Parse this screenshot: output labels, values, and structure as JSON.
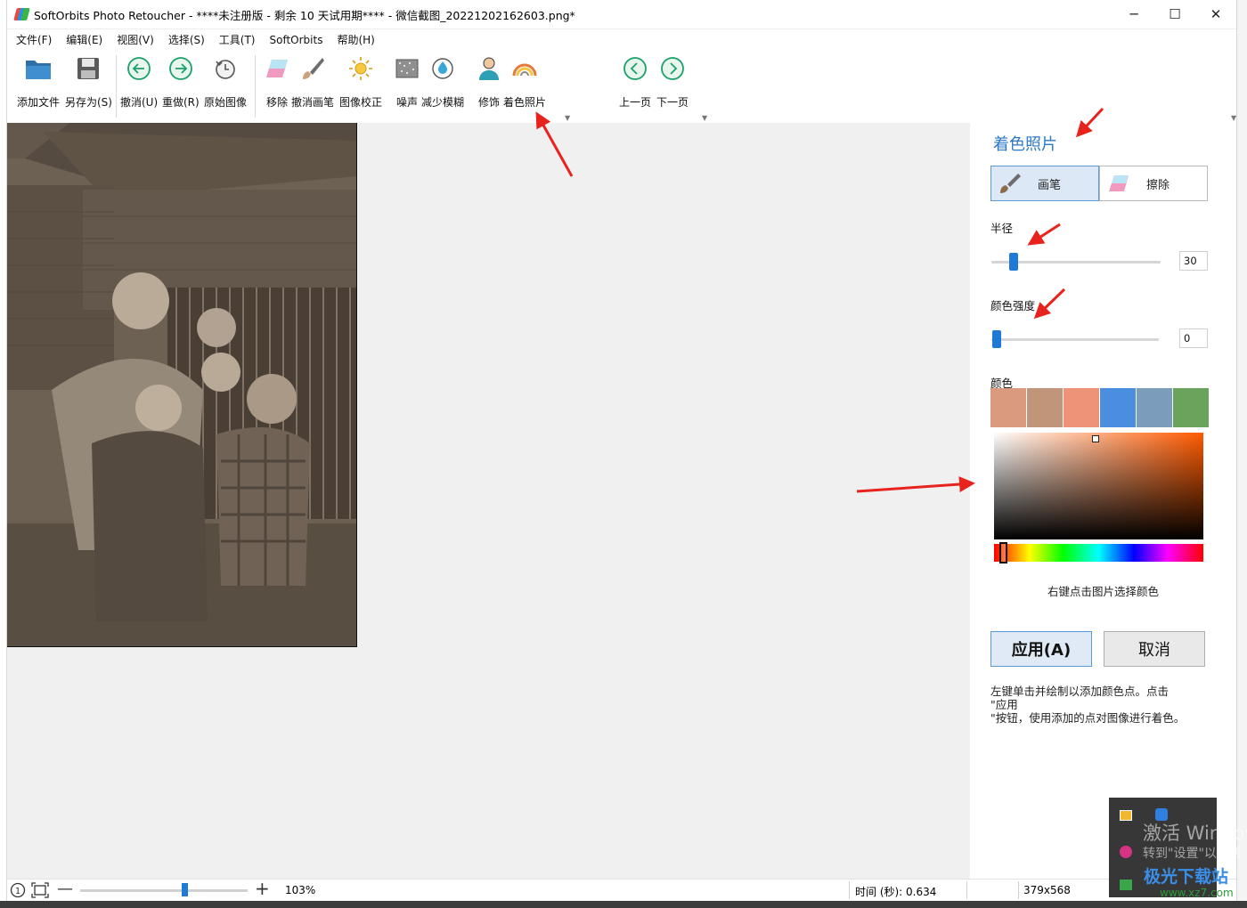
{
  "window": {
    "title": "SoftOrbits Photo Retoucher - ****未注册版 - 剩余 10 天试用期**** - 微信截图_20221202162603.png*",
    "minimize_glyph": "─",
    "maximize_glyph": "☐",
    "close_glyph": "✕"
  },
  "menu": [
    {
      "label": "文件(F)"
    },
    {
      "label": "编辑(E)"
    },
    {
      "label": "视图(V)"
    },
    {
      "label": "选择(S)"
    },
    {
      "label": "工具(T)"
    },
    {
      "label": "SoftOrbits"
    },
    {
      "label": "帮助(H)"
    }
  ],
  "toolbar": {
    "add_file": "添加文件",
    "save_as": "另存为(S)",
    "undo": "撤消(U)",
    "redo": "重做(R)",
    "original": "原始图像",
    "remove": "移除",
    "undo_brush": "撤消画笔",
    "correction": "图像校正",
    "noise": "噪声",
    "reduce_blur": "减少模糊",
    "retouch": "修饰",
    "colorize": "着色照片",
    "prev_page": "上一页",
    "next_page": "下一页"
  },
  "panel": {
    "title": "着色照片",
    "brush_label": "画笔",
    "erase_label": "擦除",
    "radius_label": "半径",
    "radius_value": "30",
    "radius_fraction": 0.07,
    "intensity_label": "颜色强度",
    "intensity_value": "0",
    "intensity_fraction": 0.0,
    "color_label": "颜色",
    "swatches": [
      "#d99a7e",
      "#c0957a",
      "#ee9278",
      "#4a8ee0",
      "#7b9cbb",
      "#6aa35c"
    ],
    "gradient_hue_color": "#ff5a00",
    "right_click_hint": "右键点击图片选择颜色",
    "apply_label": "应用(A)",
    "cancel_label": "取消",
    "help_line1": "左键单击并绘制以添加颜色点。点击",
    "help_line2": "\"应用",
    "help_line3": "\"按钮，使用添加的点对图像进行着色。"
  },
  "status": {
    "zoom": "103%",
    "zoom_fraction": 0.62,
    "time": "时间 (秒): 0.634",
    "dimensions": "379x568"
  },
  "watermark": {
    "line1": "激活 Windov",
    "line2": "转到\"设置\"以激活",
    "site_name": "极光下载站",
    "site_url": "www.xz7.com"
  },
  "colors": {
    "accent": "#1f7ad6",
    "panel_title": "#2b78c7",
    "annotation_arrow": "#e8221c"
  }
}
